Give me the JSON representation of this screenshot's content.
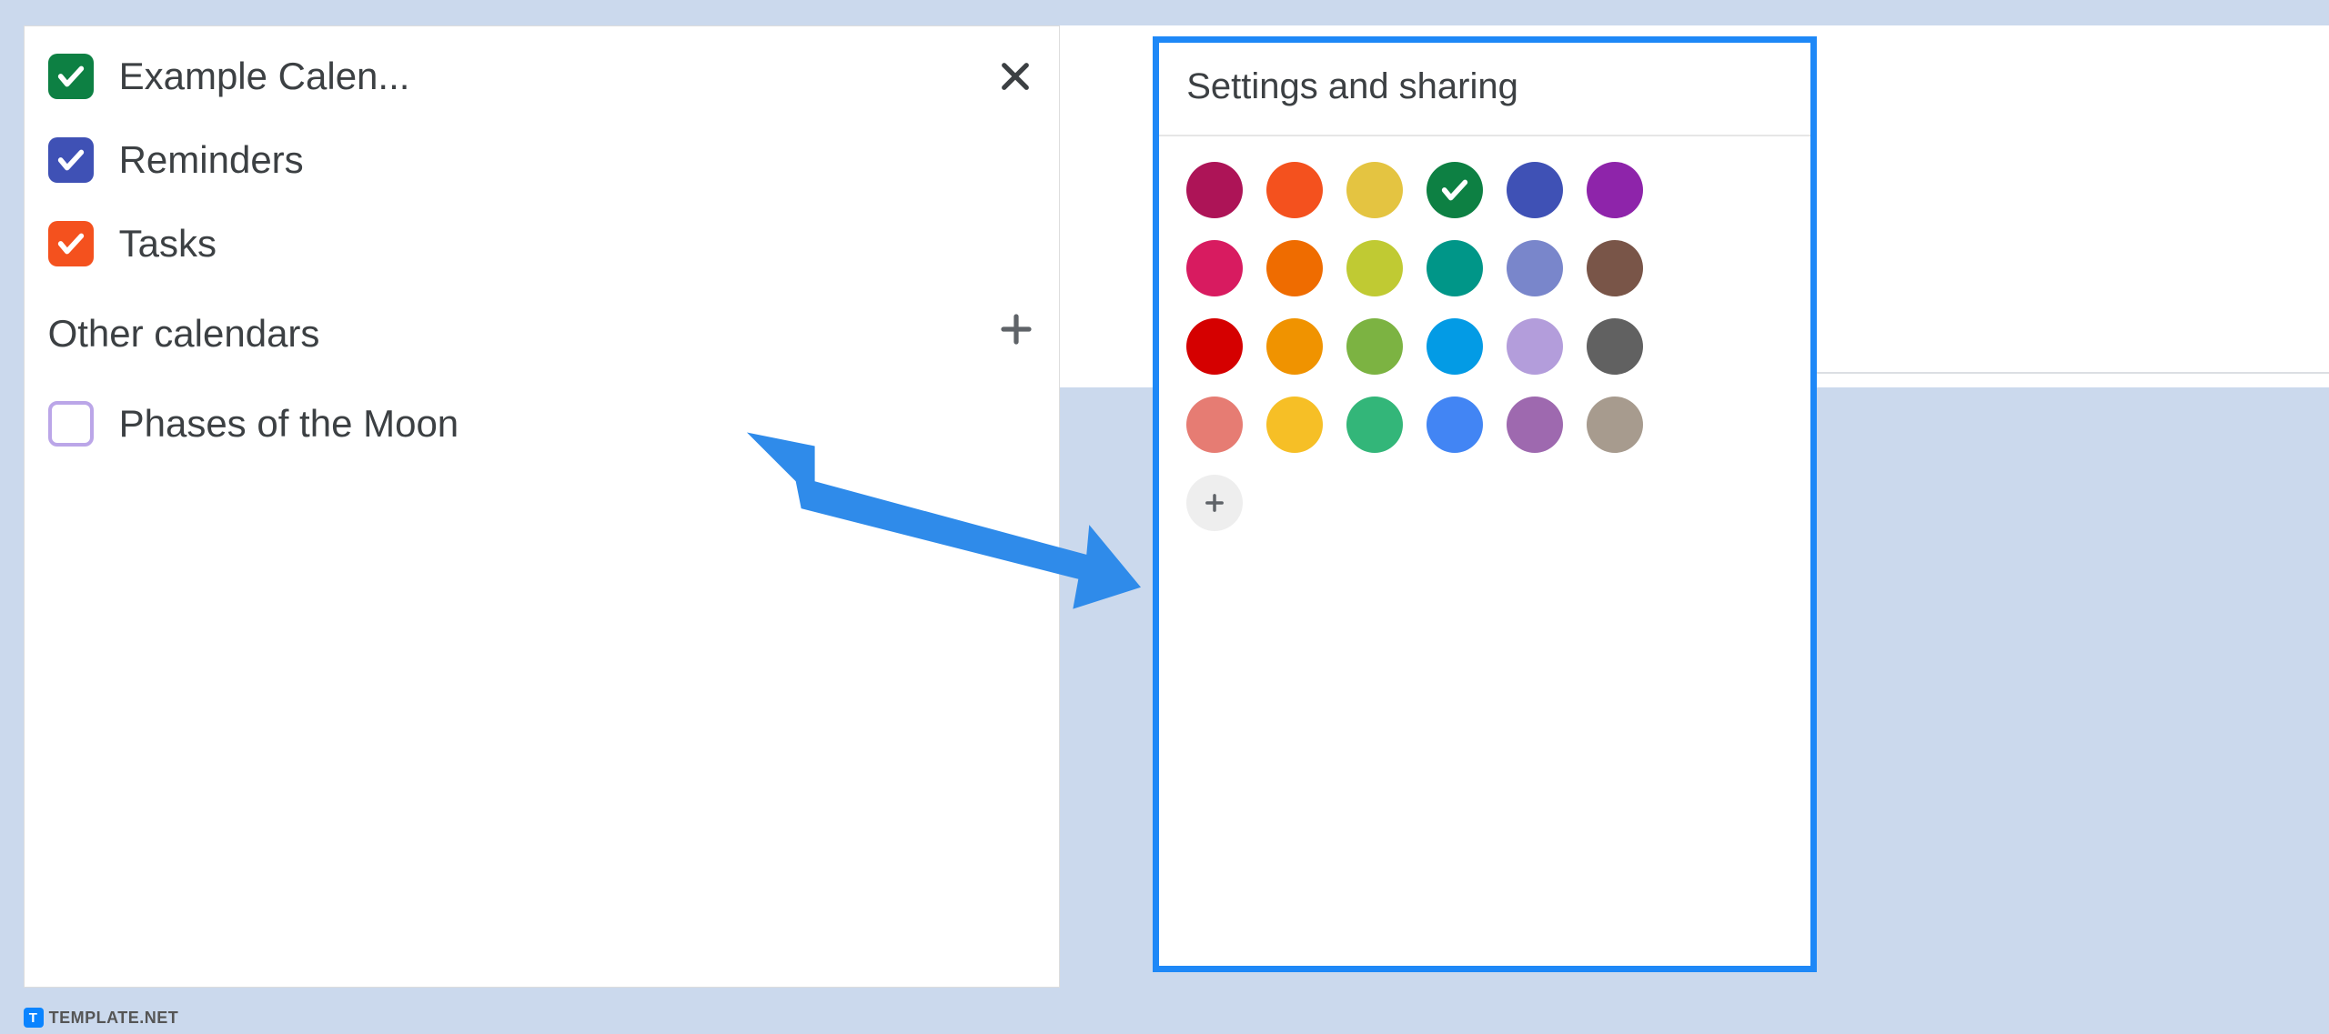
{
  "sidebar": {
    "calendars": [
      {
        "label": "Example Calen...",
        "color": "#0d8043",
        "checked": true,
        "showClose": true
      },
      {
        "label": "Reminders",
        "color": "#3f51b5",
        "checked": true,
        "showClose": false
      },
      {
        "label": "Tasks",
        "color": "#f4511e",
        "checked": true,
        "showClose": false
      }
    ],
    "other_section_label": "Other calendars",
    "other_calendars": [
      {
        "label": "Phases of the Moon",
        "color": "#bba6e8",
        "checked": false
      }
    ]
  },
  "popup": {
    "title": "Settings and sharing",
    "selected_color": "#0d8043",
    "colors": [
      "#ad1457",
      "#f4511e",
      "#e4c441",
      "#0d8043",
      "#3f51b5",
      "#8e24aa",
      "#d81b60",
      "#ef6c00",
      "#c0ca33",
      "#009688",
      "#7986cb",
      "#795548",
      "#d50000",
      "#f09300",
      "#7cb342",
      "#039be5",
      "#b39ddb",
      "#616161",
      "#e67c73",
      "#f6bf26",
      "#33b679",
      "#4285f4",
      "#9e69af",
      "#a79b8e"
    ]
  },
  "annotation": {
    "arrow_color": "#2f8bea"
  },
  "watermark": {
    "badge": "T",
    "text": "TEMPLATE.NET"
  }
}
